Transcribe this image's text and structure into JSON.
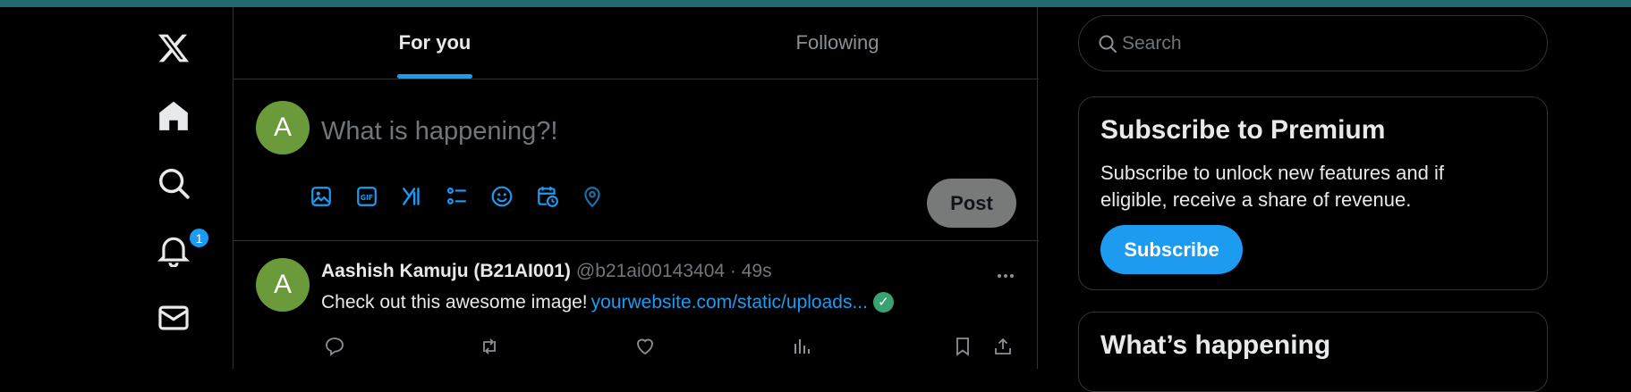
{
  "nav": {
    "items": [
      {
        "name": "x-logo-icon"
      },
      {
        "name": "home-icon"
      },
      {
        "name": "explore-search-icon"
      },
      {
        "name": "notifications-bell-icon"
      },
      {
        "name": "messages-mail-icon"
      }
    ],
    "notification_count": "1"
  },
  "tabs": [
    {
      "label": "For you",
      "active": true
    },
    {
      "label": "Following",
      "active": false
    }
  ],
  "compose": {
    "avatar_initial": "A",
    "placeholder": "What is happening?!",
    "tools": [
      "media-icon",
      "gif-icon",
      "grok-icon",
      "poll-icon",
      "emoji-icon",
      "schedule-icon",
      "location-icon"
    ],
    "post_label": "Post"
  },
  "tweet": {
    "avatar_initial": "A",
    "author_name": "Aashish Kamuju (B21AI001)",
    "meta": "@b21ai00143404 · 49s",
    "text": "Check out this awesome image!",
    "link": "yourwebsite.com/static/uploads...",
    "actions": [
      "reply-icon",
      "retweet-icon",
      "like-icon",
      "views-icon",
      "bookmark-icon",
      "share-icon"
    ]
  },
  "search": {
    "placeholder": "Search"
  },
  "premium": {
    "title": "Subscribe to Premium",
    "text": "Subscribe to unlock new features and if eligible, receive a share of revenue.",
    "button": "Subscribe"
  },
  "happening": {
    "title": "What’s happening"
  },
  "colors": {
    "accent": "#1d9bf0",
    "background": "#000000",
    "border": "#2f3336",
    "muted": "#71767b",
    "avatar": "#6a9a3a",
    "topbar": "#1f6b6f"
  }
}
